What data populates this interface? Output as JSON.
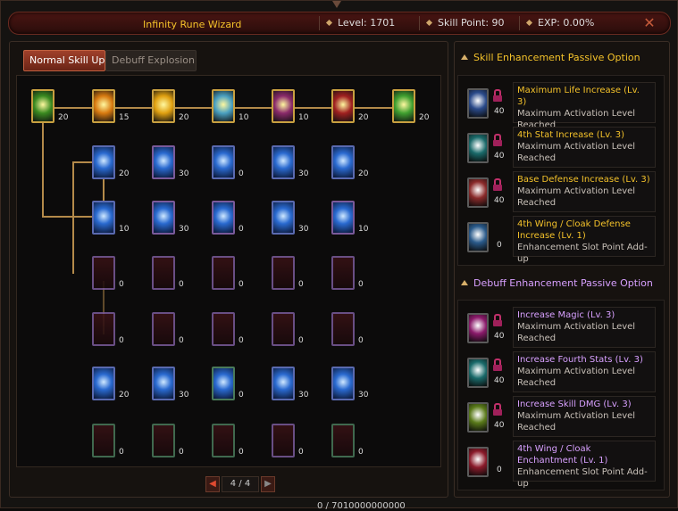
{
  "window": {
    "title": "Infinity Rune Wizard"
  },
  "stats": {
    "level": "Level: 1701",
    "skill_point": "Skill Point: 90",
    "exp": "EXP:  0.00%"
  },
  "tabs": [
    {
      "label": "Normal Skill Upgr"
    },
    {
      "label": "Debuff Explosion"
    }
  ],
  "skill_grid": {
    "row1": [
      "20",
      "15",
      "20",
      "10",
      "10",
      "20",
      "20"
    ],
    "row2": [
      "20",
      "30",
      "0",
      "30",
      "20"
    ],
    "row3": [
      "10",
      "30",
      "0",
      "30",
      "10"
    ],
    "row4": [
      "0",
      "0",
      "0",
      "0",
      "0"
    ],
    "row5": [
      "0",
      "0",
      "0",
      "0",
      "0"
    ],
    "row6": [
      "20",
      "30",
      "0",
      "30",
      "30"
    ],
    "row7": [
      "0",
      "0",
      "0",
      "0",
      "0"
    ]
  },
  "pager": {
    "text": "4 / 4"
  },
  "skill_enhancement": {
    "header": "Skill Enhancement Passive Option",
    "options": [
      {
        "title": "Maximum Life Increase (Lv. 3)",
        "desc": "Maximum Activation Level Reached",
        "count": "40",
        "color": "#f4c22a"
      },
      {
        "title": "4th Stat Increase (Lv. 3)",
        "desc": "Maximum Activation Level Reached",
        "count": "40",
        "color": "#f4c22a"
      },
      {
        "title": "Base Defense Increase (Lv. 3)",
        "desc": "Maximum Activation Level Reached",
        "count": "40",
        "color": "#f4c22a"
      },
      {
        "title": "4th Wing / Cloak Defense Increase (Lv. 1)",
        "desc": "Enhancement Slot Point Add-up",
        "count": "0",
        "color": "#f4c22a"
      }
    ]
  },
  "debuff_enhancement": {
    "header": "Debuff Enhancement Passive Option",
    "options": [
      {
        "title": "Increase Magic (Lv. 3)",
        "desc": "Maximum Activation Level Reached",
        "count": "40",
        "color": "#d8a0ff"
      },
      {
        "title": "Increase Fourth Stats (Lv. 3)",
        "desc": "Maximum Activation Level Reached",
        "count": "40",
        "color": "#d8a0ff"
      },
      {
        "title": "Increase Skill DMG (Lv. 3)",
        "desc": "Maximum Activation Level Reached",
        "count": "40",
        "color": "#d8a0ff"
      },
      {
        "title": "4th Wing / Cloak Enchantment (Lv. 1)",
        "desc": "Enhancement Slot Point Add-up",
        "count": "0",
        "color": "#d8a0ff"
      }
    ]
  },
  "footer": {
    "text": "0 / 7010000000000"
  }
}
